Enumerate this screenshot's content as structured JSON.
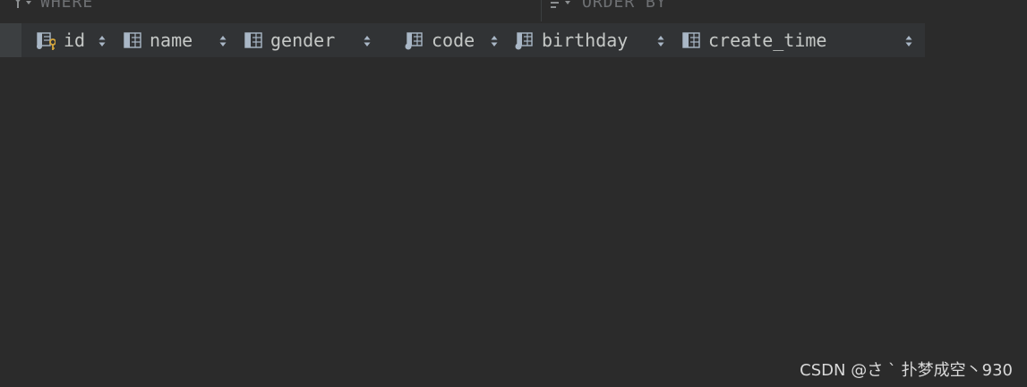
{
  "filter": {
    "where_label": "WHERE",
    "order_label": "ORDER BY"
  },
  "columns": [
    {
      "label": "id",
      "icon": "primary-key-column-icon"
    },
    {
      "label": "name",
      "icon": "table-column-icon"
    },
    {
      "label": "gender",
      "icon": "table-column-icon"
    },
    {
      "label": "code",
      "icon": "indexed-column-icon"
    },
    {
      "label": "birthday",
      "icon": "indexed-column-icon"
    },
    {
      "label": "create_time",
      "icon": "table-column-icon"
    }
  ],
  "watermark": "CSDN @さ ` 扑梦成空丶930",
  "colors": {
    "background": "#2b2b2b",
    "header": "#313335",
    "text": "#c5c8c6",
    "key": "#d6a63a"
  }
}
